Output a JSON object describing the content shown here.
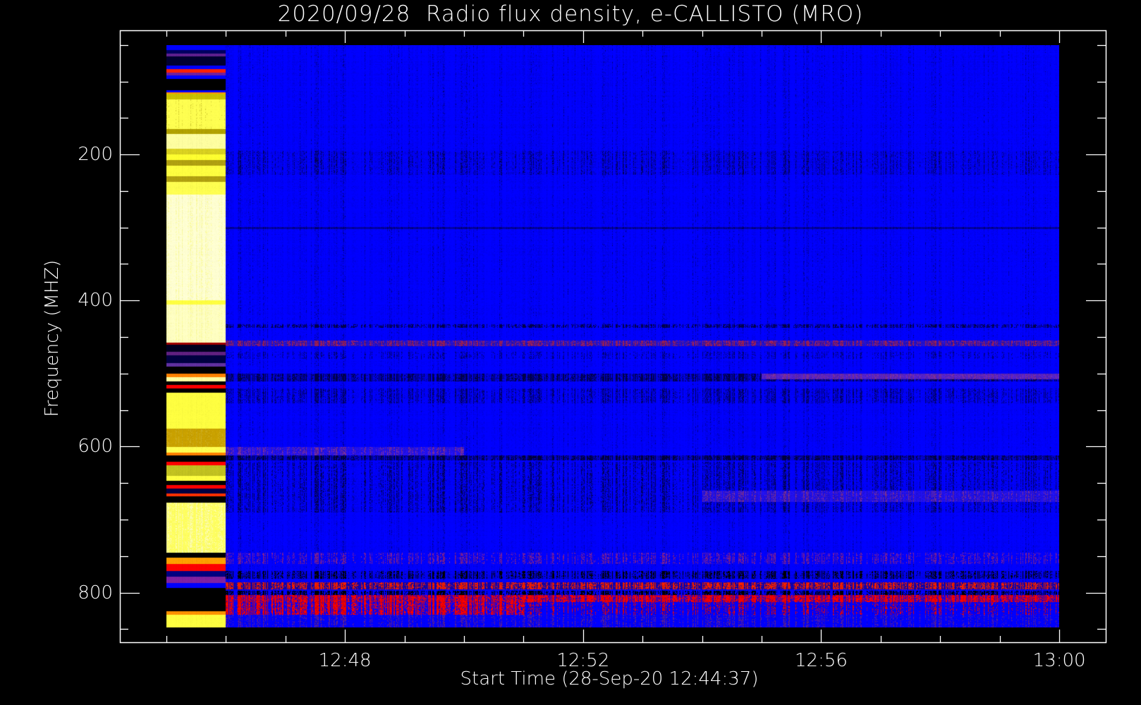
{
  "chart_data": {
    "type": "heatmap",
    "title": "2020/09/28  Radio flux density, e-CALLISTO (MRO)",
    "xlabel": "Start Time (28-Sep-20 12:44:37)",
    "ylabel": "Frequency (MHZ)",
    "x_units": "minutes after 12:00 UT",
    "xlim": [
      44.22,
      60.78
    ],
    "ylim": [
      30,
      868
    ],
    "y_reversed": true,
    "data_x_range": [
      45,
      60
    ],
    "data_y_range": [
      50.5,
      847
    ],
    "x_ticks": [
      {
        "value": 48,
        "label": "12:48"
      },
      {
        "value": 52,
        "label": "12:52"
      },
      {
        "value": 56,
        "label": "12:56"
      },
      {
        "value": 60,
        "label": "13:00"
      }
    ],
    "x_minor_step": 1,
    "y_ticks": [
      {
        "value": 200,
        "label": "200"
      },
      {
        "value": 400,
        "label": "400"
      },
      {
        "value": 600,
        "label": "600"
      },
      {
        "value": 800,
        "label": "800"
      }
    ],
    "y_minor_step": 50,
    "grid": false,
    "background_color": "#000000",
    "bands": [
      {
        "t": [
          46,
          60
        ],
        "f": [
          50.5,
          847
        ],
        "color": "#0000ff",
        "alt": "#000090",
        "alt_frac": 0.08,
        "noise": 0.25
      },
      {
        "t": [
          46,
          60
        ],
        "f": [
          195,
          228
        ],
        "color": "#0000ee",
        "alt": "#00006a",
        "alt_frac": 0.25,
        "noise": 0.3
      },
      {
        "t": [
          46,
          60
        ],
        "f": [
          299,
          302
        ],
        "color": "#0000a0",
        "alt": "#000070",
        "alt_frac": 0.3,
        "noise": 0.2
      },
      {
        "t": [
          46,
          60
        ],
        "f": [
          432,
          437
        ],
        "color": "#0000ff",
        "alt": "#000050",
        "alt_frac": 0.5,
        "noise": 0.2
      },
      {
        "t": [
          46,
          60
        ],
        "f": [
          455,
          462
        ],
        "color": "#2010c0",
        "alt": "#a02060",
        "alt_frac": 0.45,
        "noise": 0.3
      },
      {
        "t": [
          46,
          60
        ],
        "f": [
          470,
          480
        ],
        "color": "#0000ff",
        "alt": "#000080",
        "alt_frac": 0.3,
        "noise": 0.25
      },
      {
        "t": [
          46,
          60
        ],
        "f": [
          500,
          510
        ],
        "color": "#0000d0",
        "alt": "#000050",
        "alt_frac": 0.5,
        "noise": 0.25
      },
      {
        "t": [
          55,
          60
        ],
        "f": [
          500,
          508
        ],
        "color": "#5020c0",
        "alt": "#8030a0",
        "alt_frac": 0.4,
        "noise": 0.2
      },
      {
        "t": [
          46,
          60
        ],
        "f": [
          520,
          540
        ],
        "color": "#0000f0",
        "alt": "#000070",
        "alt_frac": 0.35,
        "noise": 0.3
      },
      {
        "t": [
          46,
          50
        ],
        "f": [
          600,
          612
        ],
        "color": "#2010e0",
        "alt": "#8030a0",
        "alt_frac": 0.35,
        "noise": 0.25
      },
      {
        "t": [
          46,
          60
        ],
        "f": [
          612,
          618
        ],
        "color": "#0000c0",
        "alt": "#000040",
        "alt_frac": 0.5,
        "noise": 0.25
      },
      {
        "t": [
          46,
          60
        ],
        "f": [
          620,
          690
        ],
        "color": "#0000f0",
        "alt": "#000060",
        "alt_frac": 0.3,
        "noise": 0.3
      },
      {
        "t": [
          54,
          60
        ],
        "f": [
          660,
          675
        ],
        "color": "#2010e0",
        "alt": "#8030a0",
        "alt_frac": 0.3,
        "noise": 0.25
      },
      {
        "t": [
          46,
          60
        ],
        "f": [
          745,
          760
        ],
        "color": "#0000ff",
        "alt": "#8020a0",
        "alt_frac": 0.35,
        "noise": 0.25
      },
      {
        "t": [
          46,
          60
        ],
        "f": [
          770,
          780
        ],
        "color": "#0000e0",
        "alt": "#000000",
        "alt_frac": 0.4,
        "noise": 0.25
      },
      {
        "t": [
          46,
          60
        ],
        "f": [
          785,
          795
        ],
        "color": "#1000a0",
        "alt": "#ff2000",
        "alt_frac": 0.5,
        "noise": 0.3
      },
      {
        "t": [
          46,
          60
        ],
        "f": [
          797,
          803
        ],
        "color": "#0000ff",
        "alt": "#000000",
        "alt_frac": 0.5,
        "noise": 0.25
      },
      {
        "t": [
          46,
          60
        ],
        "f": [
          803,
          812
        ],
        "color": "#2000c0",
        "alt": "#ff0000",
        "alt_frac": 0.6,
        "noise": 0.3
      },
      {
        "t": [
          46,
          60
        ],
        "f": [
          812,
          830
        ],
        "color": "#0000ff",
        "alt": "#ff0000",
        "alt_frac": 0.3,
        "noise": 0.3
      },
      {
        "t": [
          46,
          51
        ],
        "f": [
          812,
          830
        ],
        "color": "#0000ff",
        "alt": "#ff0000",
        "alt_frac": 0.55,
        "noise": 0.3
      },
      {
        "t": [
          46,
          60
        ],
        "f": [
          830,
          847
        ],
        "color": "#0000ff",
        "alt": "#6020a0",
        "alt_frac": 0.3,
        "noise": 0.25
      },
      {
        "t": [
          45,
          46
        ],
        "f": [
          50.5,
          57
        ],
        "color": "#0000ff"
      },
      {
        "t": [
          45,
          46
        ],
        "f": [
          57,
          62
        ],
        "color": "#000060"
      },
      {
        "t": [
          45,
          46
        ],
        "f": [
          62,
          66
        ],
        "color": "#602090"
      },
      {
        "t": [
          45,
          46
        ],
        "f": [
          66,
          78
        ],
        "color": "#000030"
      },
      {
        "t": [
          45,
          46
        ],
        "f": [
          78,
          83
        ],
        "color": "#0000ff"
      },
      {
        "t": [
          45,
          46
        ],
        "f": [
          83,
          88
        ],
        "color": "#ff2000"
      },
      {
        "t": [
          45,
          46
        ],
        "f": [
          88,
          92
        ],
        "color": "#7020a0"
      },
      {
        "t": [
          45,
          46
        ],
        "f": [
          92,
          97
        ],
        "color": "#0000ff"
      },
      {
        "t": [
          45,
          46
        ],
        "f": [
          97,
          112
        ],
        "color": "#000000"
      },
      {
        "t": [
          45,
          46
        ],
        "f": [
          112,
          115
        ],
        "color": "#0000ff"
      },
      {
        "t": [
          45,
          46
        ],
        "f": [
          115,
          117
        ],
        "color": "#ff9000"
      },
      {
        "t": [
          45,
          46
        ],
        "f": [
          117,
          125
        ],
        "color": "#c8c000"
      },
      {
        "t": [
          45,
          46
        ],
        "f": [
          125,
          165
        ],
        "color": "#ffff50",
        "alt": "#d8d030",
        "alt_frac": 0.2
      },
      {
        "t": [
          45,
          46
        ],
        "f": [
          165,
          172
        ],
        "color": "#b0a000"
      },
      {
        "t": [
          45,
          46
        ],
        "f": [
          172,
          192
        ],
        "color": "#ffffa0"
      },
      {
        "t": [
          45,
          46
        ],
        "f": [
          192,
          200
        ],
        "color": "#d8d020"
      },
      {
        "t": [
          45,
          46
        ],
        "f": [
          200,
          208
        ],
        "color": "#ffff30"
      },
      {
        "t": [
          45,
          46
        ],
        "f": [
          208,
          215
        ],
        "color": "#b0a010"
      },
      {
        "t": [
          45,
          46
        ],
        "f": [
          215,
          230
        ],
        "color": "#ffff40"
      },
      {
        "t": [
          45,
          46
        ],
        "f": [
          230,
          238
        ],
        "color": "#b0a010"
      },
      {
        "t": [
          45,
          46
        ],
        "f": [
          238,
          255
        ],
        "color": "#ffff50"
      },
      {
        "t": [
          45,
          46
        ],
        "f": [
          255,
          400
        ],
        "color": "#ffffd0",
        "alt": "#ffffa0",
        "alt_frac": 0.3
      },
      {
        "t": [
          45,
          46
        ],
        "f": [
          400,
          405
        ],
        "color": "#ffff40"
      },
      {
        "t": [
          45,
          46
        ],
        "f": [
          405,
          457
        ],
        "color": "#ffffc0",
        "alt": "#ffffa0",
        "alt_frac": 0.3
      },
      {
        "t": [
          45,
          46
        ],
        "f": [
          457,
          460
        ],
        "color": "#a00000"
      },
      {
        "t": [
          45,
          46
        ],
        "f": [
          460,
          470
        ],
        "color": "#000020"
      },
      {
        "t": [
          45,
          46
        ],
        "f": [
          470,
          475
        ],
        "color": "#602080"
      },
      {
        "t": [
          45,
          46
        ],
        "f": [
          475,
          485
        ],
        "color": "#000040"
      },
      {
        "t": [
          45,
          46
        ],
        "f": [
          485,
          490
        ],
        "color": "#6030a0"
      },
      {
        "t": [
          45,
          46
        ],
        "f": [
          490,
          500
        ],
        "color": "#000000"
      },
      {
        "t": [
          45,
          46
        ],
        "f": [
          500,
          505
        ],
        "color": "#ff8000"
      },
      {
        "t": [
          45,
          46
        ],
        "f": [
          505,
          510
        ],
        "color": "#ffffa0"
      },
      {
        "t": [
          45,
          46
        ],
        "f": [
          510,
          515
        ],
        "color": "#000000"
      },
      {
        "t": [
          45,
          46
        ],
        "f": [
          515,
          520
        ],
        "color": "#ff0000"
      },
      {
        "t": [
          45,
          46
        ],
        "f": [
          520,
          526
        ],
        "color": "#000000"
      },
      {
        "t": [
          45,
          46
        ],
        "f": [
          526,
          575
        ],
        "color": "#ffff40"
      },
      {
        "t": [
          45,
          46
        ],
        "f": [
          575,
          600
        ],
        "color": "#c8a000",
        "alt": "#d0b020",
        "alt_frac": 0.3
      },
      {
        "t": [
          45,
          46
        ],
        "f": [
          600,
          608
        ],
        "color": "#ffff50"
      },
      {
        "t": [
          45,
          46
        ],
        "f": [
          608,
          612
        ],
        "color": "#ff8000"
      },
      {
        "t": [
          45,
          46
        ],
        "f": [
          612,
          620
        ],
        "color": "#000000"
      },
      {
        "t": [
          45,
          46
        ],
        "f": [
          620,
          625
        ],
        "color": "#ff0000"
      },
      {
        "t": [
          45,
          46
        ],
        "f": [
          625,
          640
        ],
        "color": "#c0c020"
      },
      {
        "t": [
          45,
          46
        ],
        "f": [
          640,
          646
        ],
        "color": "#ffff40"
      },
      {
        "t": [
          45,
          46
        ],
        "f": [
          646,
          652
        ],
        "color": "#000000"
      },
      {
        "t": [
          45,
          46
        ],
        "f": [
          652,
          657
        ],
        "color": "#ff0000"
      },
      {
        "t": [
          45,
          46
        ],
        "f": [
          657,
          664
        ],
        "color": "#000040"
      },
      {
        "t": [
          45,
          46
        ],
        "f": [
          664,
          668
        ],
        "color": "#ff3000"
      },
      {
        "t": [
          45,
          46
        ],
        "f": [
          668,
          676
        ],
        "color": "#000000"
      },
      {
        "t": [
          45,
          46
        ],
        "f": [
          676,
          745
        ],
        "color": "#ffff60",
        "alt": "#ffffb0",
        "alt_frac": 0.4
      },
      {
        "t": [
          45,
          46
        ],
        "f": [
          745,
          752
        ],
        "color": "#000000"
      },
      {
        "t": [
          45,
          46
        ],
        "f": [
          752,
          760
        ],
        "color": "#ffa000"
      },
      {
        "t": [
          45,
          46
        ],
        "f": [
          760,
          770
        ],
        "color": "#ff0000"
      },
      {
        "t": [
          45,
          46
        ],
        "f": [
          770,
          778
        ],
        "color": "#000080"
      },
      {
        "t": [
          45,
          46
        ],
        "f": [
          778,
          786
        ],
        "color": "#8020a0"
      },
      {
        "t": [
          45,
          46
        ],
        "f": [
          786,
          793
        ],
        "color": "#0000ff"
      },
      {
        "t": [
          45,
          46
        ],
        "f": [
          793,
          825
        ],
        "color": "#000000"
      },
      {
        "t": [
          45,
          46
        ],
        "f": [
          825,
          830
        ],
        "color": "#ff9000"
      },
      {
        "t": [
          45,
          46
        ],
        "f": [
          830,
          847
        ],
        "color": "#ffff40"
      }
    ]
  }
}
